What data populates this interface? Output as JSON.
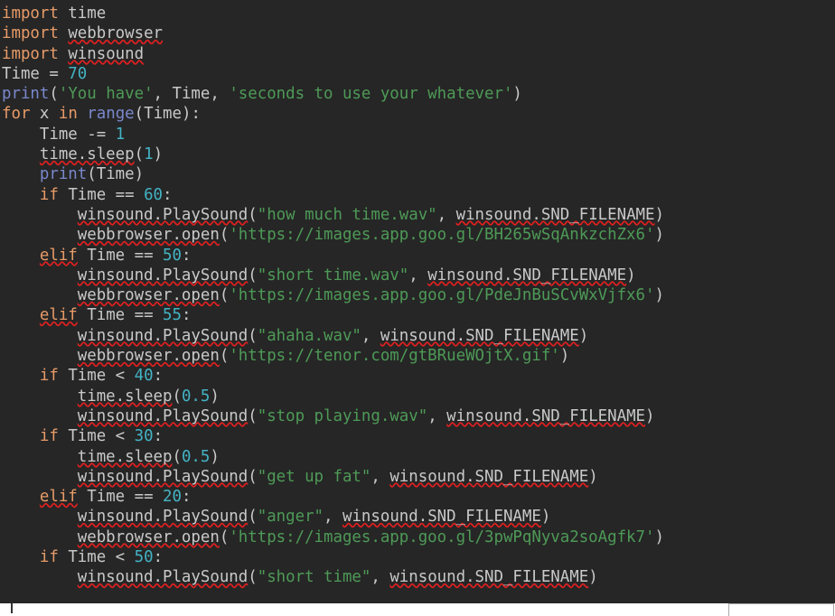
{
  "editor": {
    "language": "python",
    "background_color": "#262626",
    "colors": {
      "keyword": "#e79b68",
      "builtin": "#7a88cc",
      "number": "#43b3c4",
      "string": "#4e9a57",
      "plain": "#c9c9c9",
      "spellcheck_underline": "#e02020"
    },
    "lines": [
      {
        "n": 1,
        "indent": 0,
        "tokens": [
          {
            "t": "import",
            "c": "kw"
          },
          {
            "t": " time",
            "c": "pl"
          }
        ]
      },
      {
        "n": 2,
        "indent": 0,
        "tokens": [
          {
            "t": "import",
            "c": "kw"
          },
          {
            "t": " ",
            "c": "pl"
          },
          {
            "t": "webbrowser",
            "c": "pl",
            "sq": true
          }
        ]
      },
      {
        "n": 3,
        "indent": 0,
        "tokens": [
          {
            "t": "import",
            "c": "kw"
          },
          {
            "t": " ",
            "c": "pl"
          },
          {
            "t": "winsound",
            "c": "pl",
            "sq": true
          }
        ]
      },
      {
        "n": 4,
        "indent": 0,
        "tokens": [
          {
            "t": "Time = ",
            "c": "pl"
          },
          {
            "t": "70",
            "c": "num"
          }
        ]
      },
      {
        "n": 5,
        "indent": 0,
        "tokens": [
          {
            "t": "print",
            "c": "bi"
          },
          {
            "t": "(",
            "c": "pl"
          },
          {
            "t": "'You have'",
            "c": "str"
          },
          {
            "t": ", Time, ",
            "c": "pl"
          },
          {
            "t": "'seconds to use your whatever'",
            "c": "str"
          },
          {
            "t": ")",
            "c": "pl"
          }
        ]
      },
      {
        "n": 6,
        "indent": 0,
        "tokens": [
          {
            "t": "for",
            "c": "kw"
          },
          {
            "t": " x ",
            "c": "pl"
          },
          {
            "t": "in",
            "c": "kw"
          },
          {
            "t": " ",
            "c": "pl"
          },
          {
            "t": "range",
            "c": "bi"
          },
          {
            "t": "(Time):",
            "c": "pl"
          }
        ]
      },
      {
        "n": 7,
        "indent": 1,
        "tokens": [
          {
            "t": "Time -= ",
            "c": "pl"
          },
          {
            "t": "1",
            "c": "num"
          }
        ]
      },
      {
        "n": 8,
        "indent": 1,
        "tokens": [
          {
            "t": "time.sleep",
            "c": "pl",
            "sq": true
          },
          {
            "t": "(",
            "c": "pl"
          },
          {
            "t": "1",
            "c": "num"
          },
          {
            "t": ")",
            "c": "pl"
          }
        ]
      },
      {
        "n": 9,
        "indent": 1,
        "tokens": [
          {
            "t": "print",
            "c": "bi"
          },
          {
            "t": "(Time)",
            "c": "pl"
          }
        ]
      },
      {
        "n": 10,
        "indent": 1,
        "tokens": [
          {
            "t": "if",
            "c": "kw"
          },
          {
            "t": " Time == ",
            "c": "pl"
          },
          {
            "t": "60",
            "c": "num"
          },
          {
            "t": ":",
            "c": "pl"
          }
        ]
      },
      {
        "n": 11,
        "indent": 2,
        "tokens": [
          {
            "t": "winsound.PlaySound",
            "c": "pl",
            "sq": true
          },
          {
            "t": "(",
            "c": "pl"
          },
          {
            "t": "\"how much time.wav\"",
            "c": "str"
          },
          {
            "t": ", ",
            "c": "pl"
          },
          {
            "t": "winsound.SND_FILENAME",
            "c": "pl",
            "sq": true
          },
          {
            "t": ")",
            "c": "pl"
          }
        ]
      },
      {
        "n": 12,
        "indent": 2,
        "tokens": [
          {
            "t": "webbrowser.open",
            "c": "pl",
            "sq": true
          },
          {
            "t": "(",
            "c": "pl"
          },
          {
            "t": "'https://images.app.goo.gl/BH265wSqAnkzchZx6'",
            "c": "str"
          },
          {
            "t": ")",
            "c": "pl"
          }
        ]
      },
      {
        "n": 13,
        "indent": 1,
        "tokens": [
          {
            "t": "elif",
            "c": "kw",
            "sq": true
          },
          {
            "t": " Time == ",
            "c": "pl"
          },
          {
            "t": "50",
            "c": "num"
          },
          {
            "t": ":",
            "c": "pl"
          }
        ]
      },
      {
        "n": 14,
        "indent": 2,
        "tokens": [
          {
            "t": "winsound.PlaySound",
            "c": "pl",
            "sq": true
          },
          {
            "t": "(",
            "c": "pl"
          },
          {
            "t": "\"short time.wav\"",
            "c": "str"
          },
          {
            "t": ", ",
            "c": "pl"
          },
          {
            "t": "winsound.SND_FILENAME",
            "c": "pl",
            "sq": true
          },
          {
            "t": ")",
            "c": "pl"
          }
        ]
      },
      {
        "n": 15,
        "indent": 2,
        "tokens": [
          {
            "t": "webbrowser.open",
            "c": "pl",
            "sq": true
          },
          {
            "t": "(",
            "c": "pl"
          },
          {
            "t": "'https://images.app.goo.gl/PdeJnBuSCvWxVjfx6'",
            "c": "str"
          },
          {
            "t": ")",
            "c": "pl"
          }
        ]
      },
      {
        "n": 16,
        "indent": 1,
        "tokens": [
          {
            "t": "elif",
            "c": "kw",
            "sq": true
          },
          {
            "t": " Time == ",
            "c": "pl"
          },
          {
            "t": "55",
            "c": "num"
          },
          {
            "t": ":",
            "c": "pl"
          }
        ]
      },
      {
        "n": 17,
        "indent": 2,
        "tokens": [
          {
            "t": "winsound.PlaySound",
            "c": "pl",
            "sq": true
          },
          {
            "t": "(",
            "c": "pl"
          },
          {
            "t": "\"ahaha.wav\"",
            "c": "str"
          },
          {
            "t": ", ",
            "c": "pl"
          },
          {
            "t": "winsound.SND_FILENAME",
            "c": "pl",
            "sq": true
          },
          {
            "t": ")",
            "c": "pl"
          }
        ]
      },
      {
        "n": 18,
        "indent": 2,
        "tokens": [
          {
            "t": "webbrowser.open",
            "c": "pl",
            "sq": true
          },
          {
            "t": "(",
            "c": "pl"
          },
          {
            "t": "'https://tenor.com/gtBRueWOjtX.gif'",
            "c": "str"
          },
          {
            "t": ")",
            "c": "pl"
          }
        ]
      },
      {
        "n": 19,
        "indent": 1,
        "tokens": [
          {
            "t": "if",
            "c": "kw"
          },
          {
            "t": " Time < ",
            "c": "pl"
          },
          {
            "t": "40",
            "c": "num"
          },
          {
            "t": ":",
            "c": "pl"
          }
        ]
      },
      {
        "n": 20,
        "indent": 2,
        "tokens": [
          {
            "t": "time.sleep",
            "c": "pl",
            "sq": true
          },
          {
            "t": "(",
            "c": "pl"
          },
          {
            "t": "0.5",
            "c": "num"
          },
          {
            "t": ")",
            "c": "pl"
          }
        ]
      },
      {
        "n": 21,
        "indent": 2,
        "tokens": [
          {
            "t": "winsound.PlaySound",
            "c": "pl",
            "sq": true
          },
          {
            "t": "(",
            "c": "pl"
          },
          {
            "t": "\"stop playing.wav\"",
            "c": "str"
          },
          {
            "t": ", ",
            "c": "pl"
          },
          {
            "t": "winsound.SND_FILENAME",
            "c": "pl",
            "sq": true
          },
          {
            "t": ")",
            "c": "pl"
          }
        ]
      },
      {
        "n": 22,
        "indent": 1,
        "tokens": [
          {
            "t": "if",
            "c": "kw"
          },
          {
            "t": " Time < ",
            "c": "pl"
          },
          {
            "t": "30",
            "c": "num"
          },
          {
            "t": ":",
            "c": "pl"
          }
        ]
      },
      {
        "n": 23,
        "indent": 2,
        "tokens": [
          {
            "t": "time.sleep",
            "c": "pl",
            "sq": true
          },
          {
            "t": "(",
            "c": "pl"
          },
          {
            "t": "0.5",
            "c": "num"
          },
          {
            "t": ")",
            "c": "pl"
          }
        ]
      },
      {
        "n": 24,
        "indent": 2,
        "tokens": [
          {
            "t": "winsound.PlaySound",
            "c": "pl",
            "sq": true
          },
          {
            "t": "(",
            "c": "pl"
          },
          {
            "t": "\"get up fat\"",
            "c": "str"
          },
          {
            "t": ", ",
            "c": "pl"
          },
          {
            "t": "winsound.SND_FILENAME",
            "c": "pl",
            "sq": true
          },
          {
            "t": ")",
            "c": "pl"
          }
        ]
      },
      {
        "n": 25,
        "indent": 1,
        "tokens": [
          {
            "t": "elif",
            "c": "kw",
            "sq": true
          },
          {
            "t": " Time == ",
            "c": "pl"
          },
          {
            "t": "20",
            "c": "num"
          },
          {
            "t": ":",
            "c": "pl"
          }
        ]
      },
      {
        "n": 26,
        "indent": 2,
        "tokens": [
          {
            "t": "winsound.PlaySound",
            "c": "pl",
            "sq": true
          },
          {
            "t": "(",
            "c": "pl"
          },
          {
            "t": "\"anger\"",
            "c": "str"
          },
          {
            "t": ", ",
            "c": "pl"
          },
          {
            "t": "winsound.SND_FILENAME",
            "c": "pl",
            "sq": true
          },
          {
            "t": ")",
            "c": "pl"
          }
        ]
      },
      {
        "n": 27,
        "indent": 2,
        "tokens": [
          {
            "t": "webbrowser.open",
            "c": "pl",
            "sq": true
          },
          {
            "t": "(",
            "c": "pl"
          },
          {
            "t": "'https://images.app.goo.gl/3pwPqNyva2soAgfk7'",
            "c": "str"
          },
          {
            "t": ")",
            "c": "pl"
          }
        ]
      },
      {
        "n": 28,
        "indent": 1,
        "tokens": [
          {
            "t": "if",
            "c": "kw"
          },
          {
            "t": " Time < ",
            "c": "pl"
          },
          {
            "t": "50",
            "c": "num"
          },
          {
            "t": ":",
            "c": "pl"
          }
        ]
      },
      {
        "n": 29,
        "indent": 2,
        "tokens": [
          {
            "t": "winsound.PlaySound",
            "c": "pl",
            "sq": true
          },
          {
            "t": "(",
            "c": "pl"
          },
          {
            "t": "\"short time\"",
            "c": "str"
          },
          {
            "t": ", ",
            "c": "pl"
          },
          {
            "t": "winsound.SND_FILENAME",
            "c": "pl",
            "sq": true
          },
          {
            "t": ")",
            "c": "pl"
          }
        ]
      }
    ]
  },
  "bottom_bar": {
    "cursor_visible": true,
    "box_label": ""
  }
}
